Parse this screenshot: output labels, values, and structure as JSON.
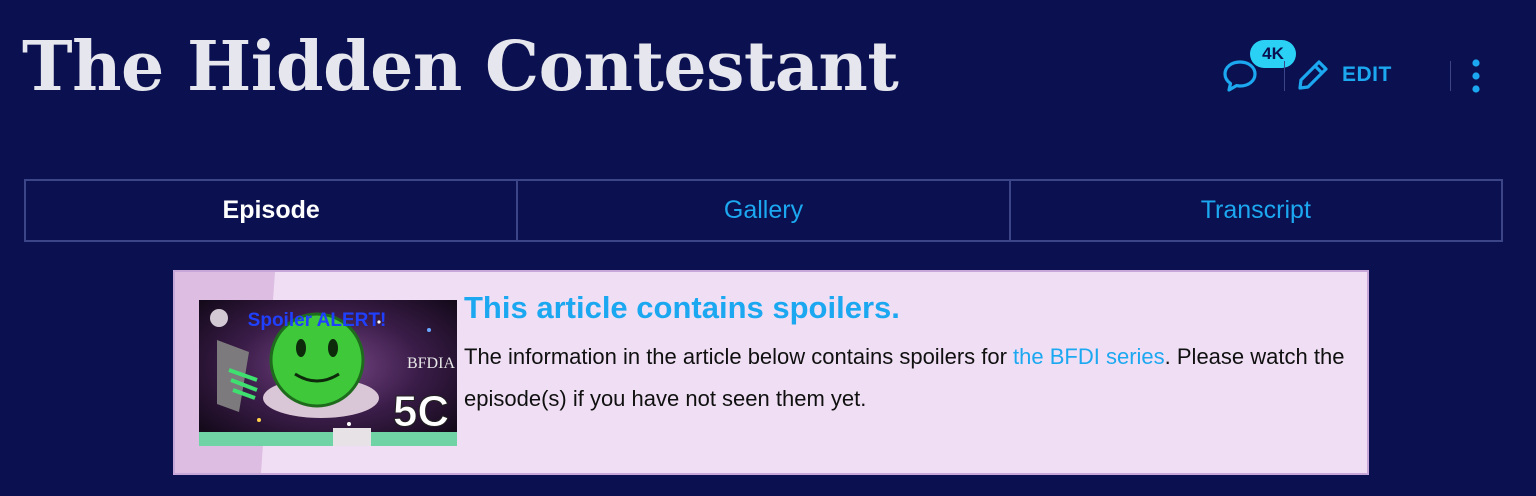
{
  "page": {
    "title": "The Hidden Contestant"
  },
  "actions": {
    "comment_count": "4K",
    "edit_label": "EDIT",
    "comments_icon": "speech-bubble-icon",
    "edit_icon": "pencil-icon",
    "more_icon": "vertical-ellipsis-icon"
  },
  "tabs": [
    {
      "label": "Episode",
      "active": true
    },
    {
      "label": "Gallery",
      "active": false
    },
    {
      "label": "Transcript",
      "active": false
    }
  ],
  "spoiler": {
    "heading": "This article contains spoilers.",
    "body_before": "The information in the article below contains spoilers for ",
    "link_text": "the BFDI series",
    "body_after": ". Please watch the episode(s) if you have not seen them yet.",
    "image": {
      "caption": "Spoiler ALERT!",
      "series_label": "BFDIA",
      "episode_label": "5C"
    }
  },
  "colors": {
    "background": "#0b1150",
    "accent": "#1ca8f0",
    "badge": "#2ad1f5",
    "title_text": "#e6e6ee",
    "spoiler_background": "#f0dff4",
    "spoiler_border": "#c7a6da"
  }
}
